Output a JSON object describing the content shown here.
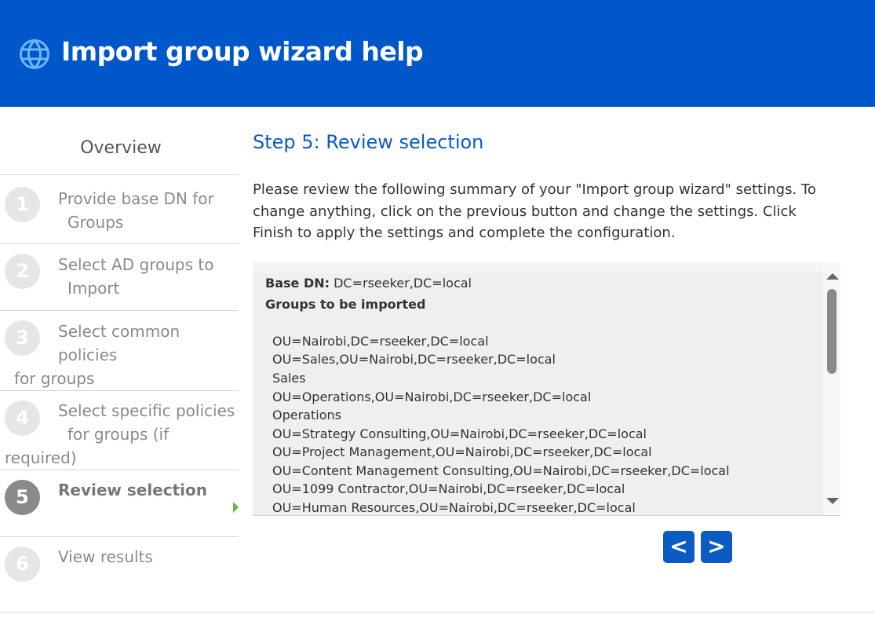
{
  "header": {
    "icon": "globe-icon",
    "title": "Import group wizard help",
    "color": "#0057c9"
  },
  "sidebar": {
    "overview": "Overview",
    "steps": [
      {
        "number": "1",
        "lines": [
          "Provide base DN for",
          "Groups"
        ]
      },
      {
        "number": "2",
        "lines": [
          "Select AD groups to",
          "Import"
        ]
      },
      {
        "number": "3",
        "lines": [
          "Select common",
          "policies",
          "for groups"
        ]
      },
      {
        "number": "4",
        "lines": [
          "Select specific policies",
          "for groups (if",
          "required)"
        ]
      },
      {
        "number": "5",
        "lines": [
          "Review selection"
        ],
        "active": true
      },
      {
        "number": "6",
        "lines": [
          "View results"
        ]
      }
    ]
  },
  "main": {
    "step_title": "Step 5: Review selection",
    "intro": "Please review the following summary of your \"Import group wizard\" settings. To change anything, click on the previous button and change the settings. Click Finish to apply the settings and complete the configuration."
  },
  "summary": {
    "base_dn_label": "Base DN:",
    "base_dn_value": " DC=rseeker,DC=local",
    "groups_heading": "Groups to be imported",
    "groups": [
      "OU=Nairobi,DC=rseeker,DC=local",
      "OU=Sales,OU=Nairobi,DC=rseeker,DC=local",
      "Sales",
      "OU=Operations,OU=Nairobi,DC=rseeker,DC=local",
      "Operations",
      "OU=Strategy Consulting,OU=Nairobi,DC=rseeker,DC=local",
      "OU=Project Management,OU=Nairobi,DC=rseeker,DC=local",
      "OU=Content Management Consulting,OU=Nairobi,DC=rseeker,DC=local",
      "OU=1099 Contractor,OU=Nairobi,DC=rseeker,DC=local",
      "OU=Human Resources,OU=Nairobi,DC=rseeker,DC=local"
    ]
  },
  "nav": {
    "prev_label": "<",
    "next_label": ">",
    "color": "#0b5bc4"
  }
}
